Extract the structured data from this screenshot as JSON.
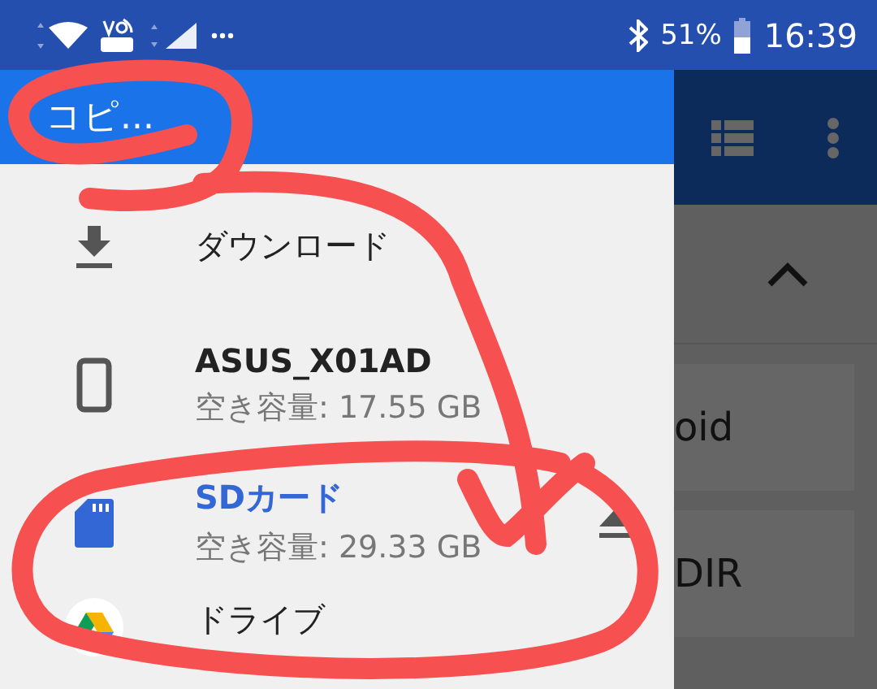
{
  "status_bar": {
    "battery": "51%",
    "time": "16:39"
  },
  "drawer": {
    "title": "コピ...",
    "items": [
      {
        "kind": "download",
        "label": "ダウンロード",
        "selected": false
      },
      {
        "kind": "device",
        "label": "ASUS_X01AD",
        "detail": "空き容量: 17.55 GB",
        "selected": false
      },
      {
        "kind": "sdcard",
        "label": "SDカード",
        "detail": "空き容量: 29.33 GB",
        "eject": true,
        "selected": true
      },
      {
        "kind": "drive",
        "label": "ドライブ",
        "selected": false
      }
    ]
  },
  "background": {
    "cards": [
      "oid",
      "DIR"
    ]
  }
}
